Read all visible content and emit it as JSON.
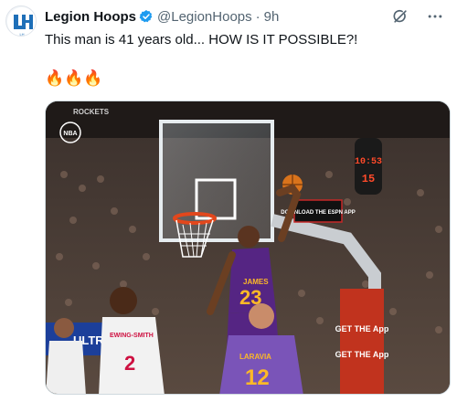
{
  "author": {
    "name": "Legion Hoops",
    "handle": "@LegionHoops",
    "separator": "·",
    "time": "9h",
    "verified": true,
    "avatar_letters": "LH"
  },
  "icons": [
    "verified-badge-icon",
    "grok-icon",
    "more-icon"
  ],
  "tweet": {
    "text": "This man is 41 years old... HOW IS IT POSSIBLE?!",
    "emoji": "🔥🔥🔥"
  },
  "media": {
    "scoreboard_top": "10:53",
    "scoreboard_bottom": "15",
    "player_main_name": "JAMES",
    "player_main_number": "23",
    "player_front_name": "LARAVIA",
    "player_front_number": "12",
    "player_left_name": "EWING-SMITH",
    "player_left_number": "2",
    "ad_download": "DOWNLOAD THE ESPN APP",
    "ad_get_app_1": "GET THE App",
    "ad_get_app_2": "GET THE App",
    "ad_ultra": "ULTRA",
    "corner_logo": "NBA",
    "rockets_small": "ROCKETS"
  },
  "colors": {
    "accent": "#1d9bf0",
    "lakers_purple": "#552583",
    "lakers_gold": "#fdb927",
    "rockets_red": "#ce1141",
    "text_primary": "#0f1419",
    "text_secondary": "#536471"
  }
}
